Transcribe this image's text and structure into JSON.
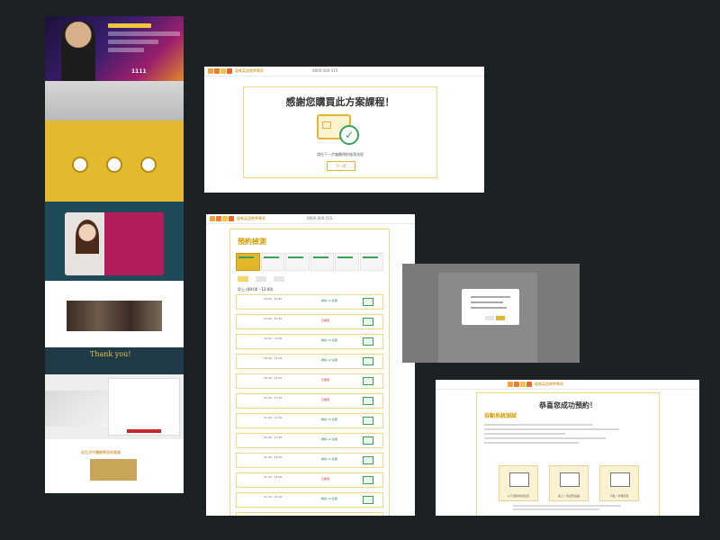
{
  "landing": {
    "hero_headline": "11/11 超值優惠 這次要你學到會",
    "hero_price": "1990",
    "hero_date": "1111",
    "thank_you": "Thank you!",
    "bottom_title": "從生活中體驗學習的樂趣"
  },
  "thanks_page": {
    "brand": "優質英語教學專家",
    "phone": "0800-000-515",
    "title": "感謝您購買此方案課程！",
    "message": "請在下一步繼續預約檢測流程",
    "next_button": "下一步"
  },
  "booking_page": {
    "title": "預約檢測",
    "section": "早上 (09:00 - 12:00)",
    "slots": [
      {
        "time": "10:00 - 10:30",
        "status": "剩餘 10 名額",
        "state": "ok"
      },
      {
        "time": "10:00 - 10:30",
        "status": "已額滿",
        "state": "full"
      },
      {
        "time": "10:30 - 11:00",
        "status": "剩餘 10 名額",
        "state": "ok"
      },
      {
        "time": "10:30 - 11:00",
        "status": "剩餘 10 名額",
        "state": "ok"
      },
      {
        "time": "10:30 - 11:00",
        "status": "已額滿",
        "state": "full"
      },
      {
        "time": "11:00 - 11:30",
        "status": "已額滿",
        "state": "full"
      },
      {
        "time": "11:00 - 11:30",
        "status": "剩餘 10 名額",
        "state": "ok"
      },
      {
        "time": "11:00 - 11:30",
        "status": "剩餘 10 名額",
        "state": "ok"
      },
      {
        "time": "11:30 - 12:00",
        "status": "剩餘 10 名額",
        "state": "ok"
      },
      {
        "time": "11:30 - 12:00",
        "status": "已額滿",
        "state": "full"
      },
      {
        "time": "11:30 - 12:00",
        "status": "剩餘 10 名額",
        "state": "ok"
      },
      {
        "time": "12:00 - 12:30",
        "status": "剩餘 10 名額",
        "state": "ok"
      }
    ]
  },
  "success_page": {
    "title": "恭喜您成功預約！",
    "subtitle": "自動系統測試",
    "tiles": [
      "以下選擇你的裝置",
      "桌上 / 筆記型電腦",
      "平板 / 手機裝置"
    ]
  }
}
